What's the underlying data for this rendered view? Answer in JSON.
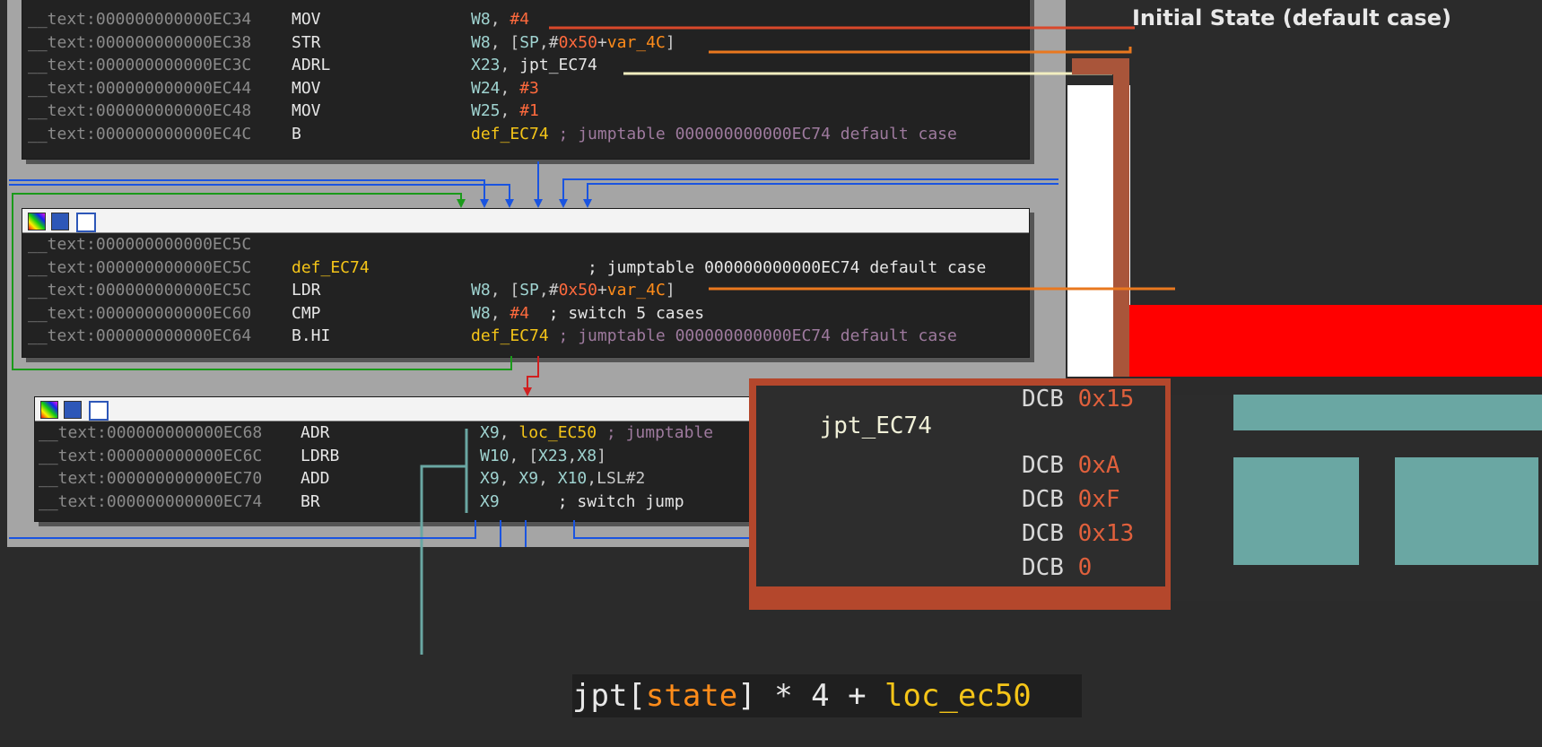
{
  "block1": {
    "rows": [
      {
        "addr": "__text:000000000000EC34",
        "mn": "MOV",
        "ops": [
          [
            "W8",
            "c-w"
          ],
          [
            ", ",
            "c-br"
          ],
          [
            "#4",
            "c-num"
          ]
        ]
      },
      {
        "addr": "__text:000000000000EC38",
        "mn": "STR",
        "ops": [
          [
            "W8",
            "c-w"
          ],
          [
            ", [",
            "c-br"
          ],
          [
            "SP",
            "c-w"
          ],
          [
            ",#",
            "c-br"
          ],
          [
            "0x50",
            "c-num"
          ],
          [
            "+",
            "c-br"
          ],
          [
            "var_4C",
            "c-var"
          ],
          [
            "]",
            "c-br"
          ]
        ]
      },
      {
        "addr": "__text:000000000000EC3C",
        "mn": "ADRL",
        "ops": [
          [
            "X23",
            "c-w"
          ],
          [
            ", ",
            "c-br"
          ],
          [
            "jpt_EC74",
            "c-cmt2"
          ]
        ]
      },
      {
        "addr": "__text:000000000000EC44",
        "mn": "MOV",
        "ops": [
          [
            "W24",
            "c-w"
          ],
          [
            ", ",
            "c-br"
          ],
          [
            "#3",
            "c-num"
          ]
        ]
      },
      {
        "addr": "__text:000000000000EC48",
        "mn": "MOV",
        "ops": [
          [
            "W25",
            "c-w"
          ],
          [
            ", ",
            "c-br"
          ],
          [
            "#1",
            "c-num"
          ]
        ]
      },
      {
        "addr": "__text:000000000000EC4C",
        "mn": "B",
        "ops": [
          [
            "def_EC74",
            "c-def"
          ],
          [
            " ; jumptable 000000000000EC74 default case",
            "c-cmt"
          ]
        ]
      }
    ]
  },
  "block2": {
    "rows": [
      {
        "addr": "__text:000000000000EC5C",
        "mn": "",
        "ops": []
      },
      {
        "addr": "__text:000000000000EC5C",
        "mn": "def_EC74",
        "mnClass": "c-def",
        "ops": [
          [
            "            ; jumptable 000000000000EC74 default case",
            "c-cmt2"
          ]
        ]
      },
      {
        "addr": "__text:000000000000EC5C",
        "mn": "LDR",
        "ops": [
          [
            "W8",
            "c-w"
          ],
          [
            ", [",
            "c-br"
          ],
          [
            "SP",
            "c-w"
          ],
          [
            ",#",
            "c-br"
          ],
          [
            "0x50",
            "c-num"
          ],
          [
            "+",
            "c-br"
          ],
          [
            "var_4C",
            "c-var"
          ],
          [
            "]",
            "c-br"
          ]
        ]
      },
      {
        "addr": "__text:000000000000EC60",
        "mn": "CMP",
        "ops": [
          [
            "W8",
            "c-w"
          ],
          [
            ", ",
            "c-br"
          ],
          [
            "#4",
            "c-num"
          ],
          [
            "  ; switch 5 cases",
            "c-cmt2"
          ]
        ]
      },
      {
        "addr": "__text:000000000000EC64",
        "mn": "B.HI",
        "ops": [
          [
            "def_EC74",
            "c-def"
          ],
          [
            " ; jumptable 000000000000EC74 default case",
            "c-cmt"
          ]
        ]
      }
    ]
  },
  "block3": {
    "rows": [
      {
        "addr": "__text:000000000000EC68",
        "mn": "ADR",
        "ops": [
          [
            "X9",
            "c-w"
          ],
          [
            ", ",
            "c-br"
          ],
          [
            "loc_EC50",
            "c-lbl"
          ],
          [
            " ; jumptable",
            "c-cmt"
          ]
        ]
      },
      {
        "addr": "__text:000000000000EC6C",
        "mn": "LDRB",
        "ops": [
          [
            "W10",
            "c-w"
          ],
          [
            ", [",
            "c-br"
          ],
          [
            "X23",
            "c-w"
          ],
          [
            ",",
            "c-br"
          ],
          [
            "X8",
            "c-w"
          ],
          [
            "]",
            "c-br"
          ]
        ]
      },
      {
        "addr": "__text:000000000000EC70",
        "mn": "ADD",
        "ops": [
          [
            "X9",
            "c-w"
          ],
          [
            ", ",
            "c-br"
          ],
          [
            "X9",
            "c-w"
          ],
          [
            ", ",
            "c-br"
          ],
          [
            "X10",
            "c-w"
          ],
          [
            ",LSL#2",
            "c-br"
          ]
        ]
      },
      {
        "addr": "__text:000000000000EC74",
        "mn": "BR",
        "ops": [
          [
            "X9",
            "c-w"
          ],
          [
            "      ; switch jump",
            "c-cmt2"
          ]
        ]
      }
    ]
  },
  "jumptable": {
    "name": "jpt_EC74",
    "entries": [
      {
        "kw": "DCB",
        "val": "0x15"
      },
      {
        "kw": "DCB",
        "val": "0xA"
      },
      {
        "kw": "DCB",
        "val": "0xF"
      },
      {
        "kw": "DCB",
        "val": "0x13"
      },
      {
        "kw": "DCB",
        "val": "0"
      }
    ]
  },
  "formula": {
    "jpt": "jpt[",
    "state": "state",
    "rest": "] * 4 + ",
    "loc": "loc_ec50"
  },
  "annotations": {
    "initial_state": "Initial State (default case)"
  },
  "colors": {
    "orange_line": "#e9781f",
    "red_line": "#d9482b",
    "cream_line": "#f2eec0",
    "teal_line": "#6aa7a3",
    "jpt_border": "#b4472c"
  }
}
